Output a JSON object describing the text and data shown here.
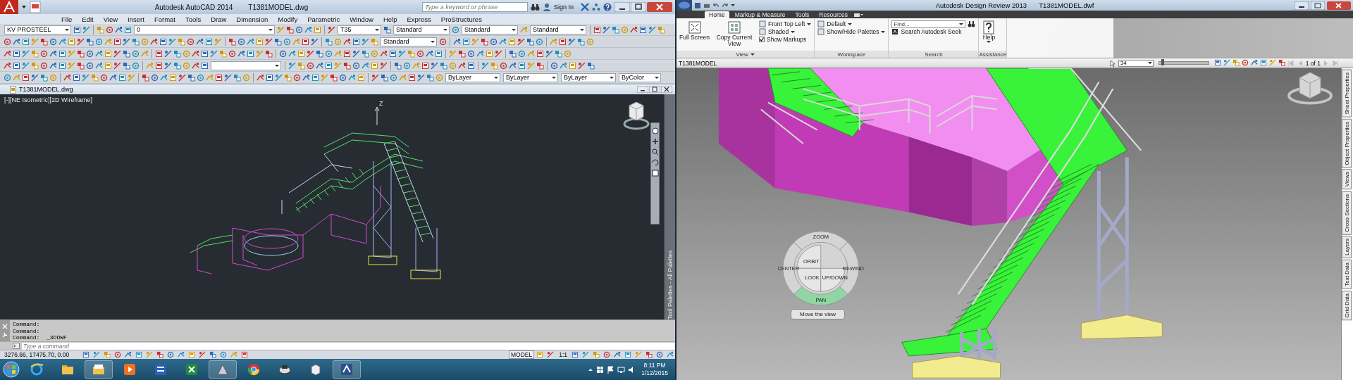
{
  "autocad": {
    "title": "Autodesk AutoCAD 2014",
    "document": "T1381MODEL.dwg",
    "search": {
      "placeholder": "Type a keyword or phrase"
    },
    "sign_in": "Sign In",
    "menu": [
      "File",
      "Edit",
      "View",
      "Insert",
      "Format",
      "Tools",
      "Draw",
      "Dimension",
      "Modify",
      "Parametric",
      "Window",
      "Help",
      "Express",
      "ProStructures"
    ],
    "toolbars": {
      "row_1": [
        "KV PROSTEEL",
        "0",
        "T35",
        "Standard",
        "Standard",
        "Standard"
      ],
      "row_2": [
        "Standard"
      ],
      "row_5": [
        "ByLayer",
        "ByLayer",
        "ByLayer",
        "ByColor"
      ]
    },
    "drawing_tab": "T1381MODEL.dwg",
    "viewport_label": "[-][NE Isometric][2D Wireframe]",
    "axis_label": "Z",
    "palette_title": "Tool Palettes - All Palettes",
    "command_history": [
      "Command:",
      "Command:",
      "Command:  _3DDWF"
    ],
    "command_input": {
      "placeholder": "Type a command"
    },
    "status": {
      "coordinates": "3276.66, 17475.70, 0.00",
      "space": "MODEL",
      "scale": "1:1"
    }
  },
  "design_review": {
    "title": "Autodesk Design Review 2013",
    "document": "T1381MODEL.dwf",
    "tabs": [
      {
        "label": "Home",
        "selected": true
      },
      {
        "label": "Markup & Measure",
        "selected": false
      },
      {
        "label": "Tools",
        "selected": false
      },
      {
        "label": "Resources",
        "selected": false
      }
    ],
    "groups": [
      {
        "label": "View",
        "items": [
          {
            "kind": "large",
            "label": "Full Screen"
          },
          {
            "kind": "large",
            "label": "Copy Current View"
          },
          {
            "kind": "small_menu",
            "label": "Front Top Left"
          },
          {
            "kind": "small_menu",
            "label": "Shaded"
          },
          {
            "kind": "checkbox",
            "label": "Show Markups",
            "checked": true
          }
        ]
      },
      {
        "label": "Workspace",
        "items": [
          {
            "kind": "small_menu",
            "label": "Default"
          },
          {
            "kind": "small_menu",
            "label": "Show/Hide Palettes"
          }
        ]
      },
      {
        "label": "Search",
        "items": [
          {
            "kind": "search",
            "placeholder": "Find..."
          },
          {
            "kind": "small",
            "label": "Search Autodesk Seek"
          }
        ]
      },
      {
        "label": "Assistance",
        "items": [
          {
            "kind": "large_menu",
            "label": "Help"
          }
        ]
      }
    ],
    "sheet": "T1381MODEL",
    "zoom_value": "34",
    "zoom_slider": {
      "level": 0.05
    },
    "page": "1 of 1",
    "side_tabs": [
      "Sheet Properties",
      "Object Properties",
      "Views",
      "Cross Sections",
      "Layers",
      "Text Data",
      "Grid Data"
    ],
    "nav_wheel": {
      "wedges": [
        {
          "label": "ZOOM",
          "selected": false
        },
        {
          "label": "REWIND",
          "selected": false
        },
        {
          "label": "PAN",
          "selected": true
        },
        {
          "label": "CENTER",
          "selected": false
        },
        {
          "label": "ORBIT",
          "selected": false
        },
        {
          "label": "LOOK",
          "selected": false
        },
        {
          "label": "UP/DOWN",
          "selected": false
        }
      ],
      "tooltip": "Move the view"
    }
  },
  "taskbar": {
    "time": "8:11 PM",
    "date": "1/12/2015"
  }
}
